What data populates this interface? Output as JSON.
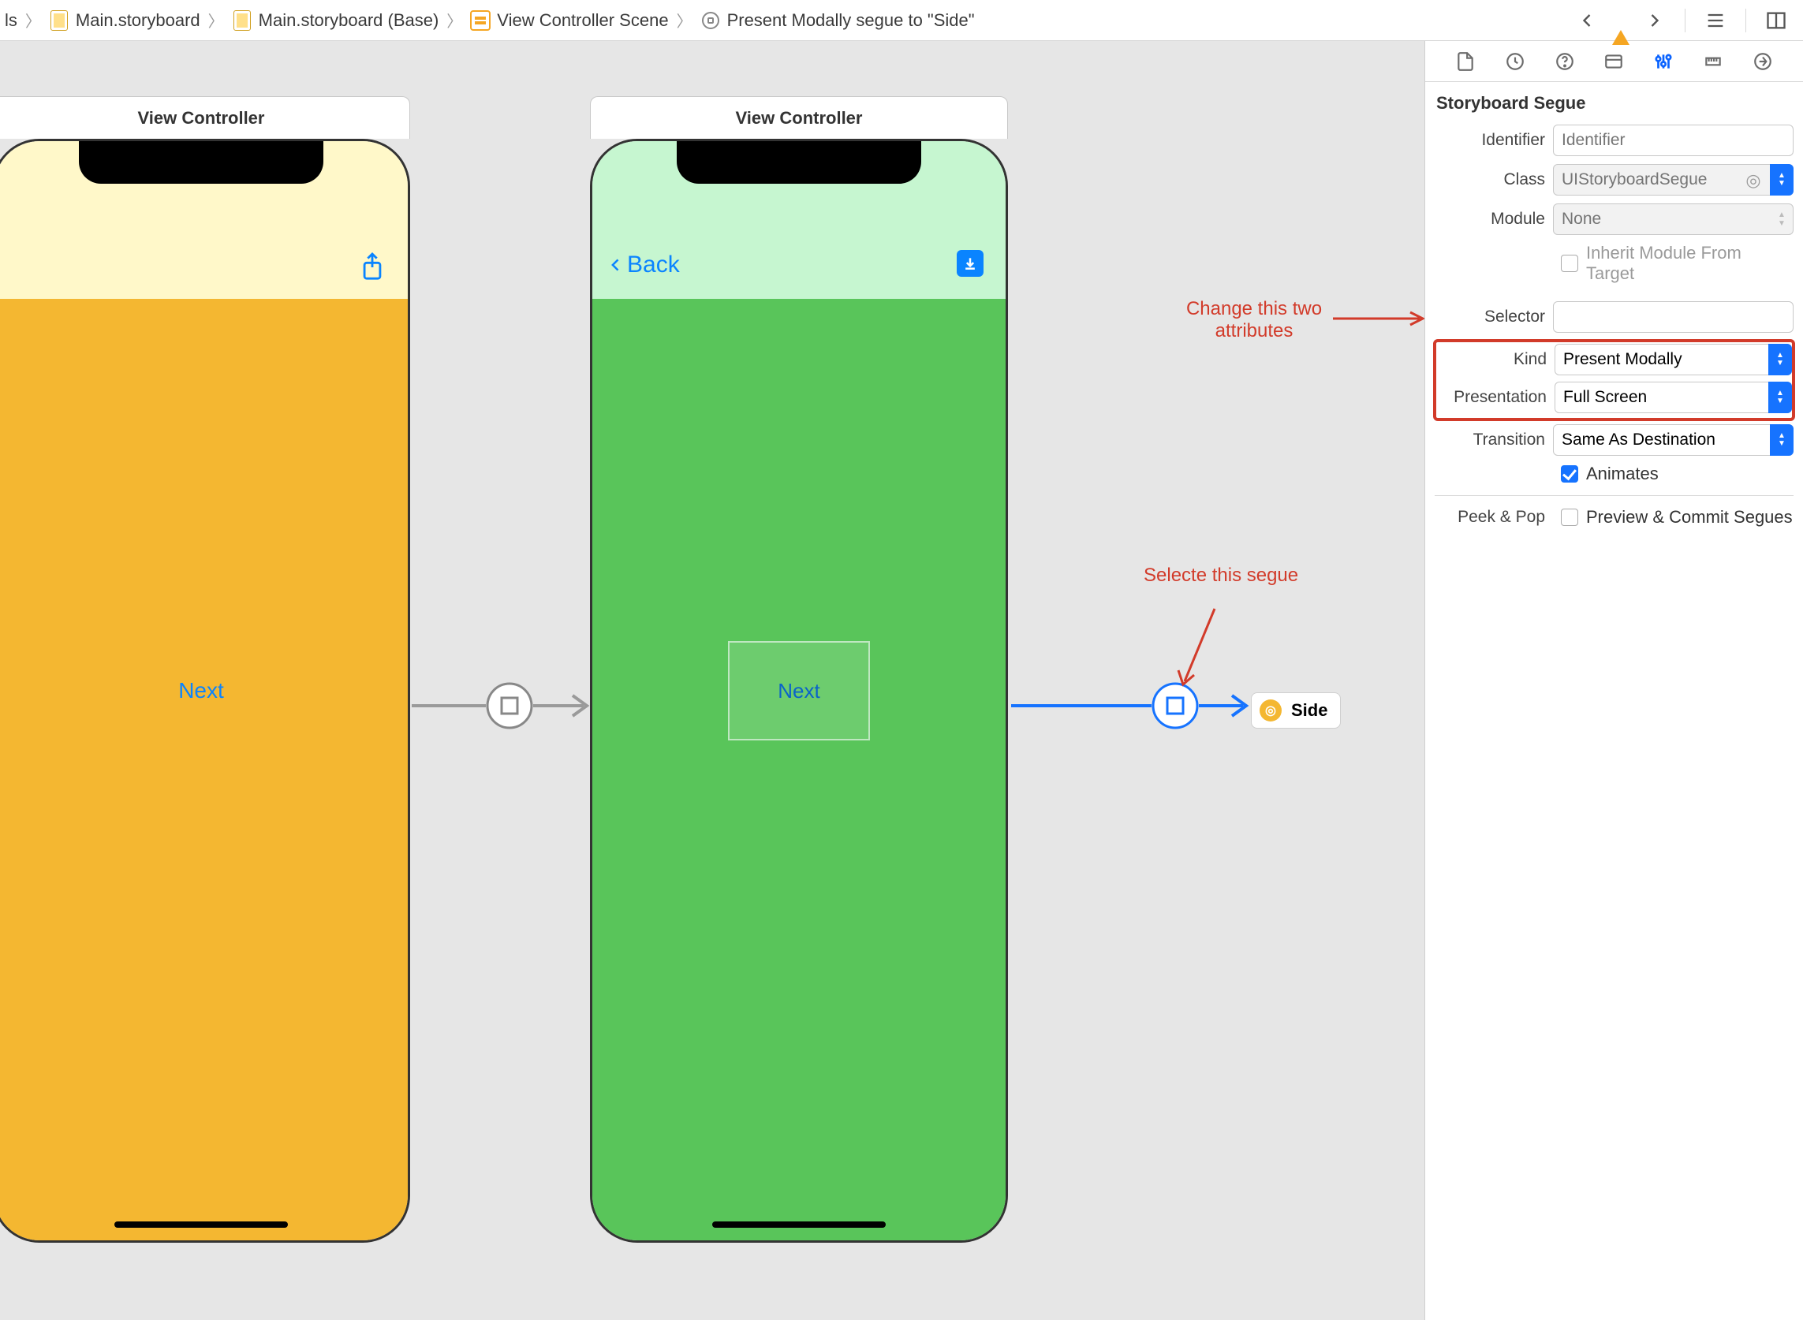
{
  "breadcrumbs": {
    "item0": "ls",
    "item1": "Main.storyboard",
    "item2": "Main.storyboard (Base)",
    "item3": "View Controller Scene",
    "item4": "Present Modally segue to \"Side\""
  },
  "scenes": {
    "scene1_title": "View Controller",
    "scene1_button": "Next",
    "scene2_title": "View Controller",
    "scene2_back": "Back",
    "scene2_button": "Next",
    "side_ref_label": "Side"
  },
  "annotations": {
    "attrs_note_l1": "Change this two",
    "attrs_note_l2": "attributes",
    "segue_note": "Selecte this segue"
  },
  "inspector": {
    "section_title": "Storyboard Segue",
    "labels": {
      "identifier": "Identifier",
      "class": "Class",
      "module": "Module",
      "inherit": "Inherit Module From Target",
      "selector": "Selector",
      "kind": "Kind",
      "presentation": "Presentation",
      "transition": "Transition",
      "animates": "Animates",
      "peek": "Peek & Pop",
      "peek_chk": "Preview & Commit Segues"
    },
    "values": {
      "identifier_ph": "Identifier",
      "class_ph": "UIStoryboardSegue",
      "module_ph": "None",
      "selector": "",
      "kind": "Present Modally",
      "presentation": "Full Screen",
      "transition": "Same As Destination"
    }
  }
}
